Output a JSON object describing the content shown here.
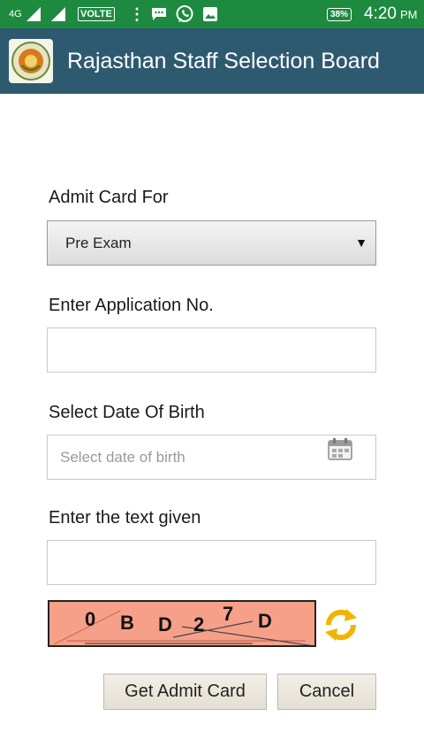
{
  "status_bar": {
    "network": "4G",
    "volte": "VOLTE",
    "battery": "38%",
    "time": "4:20",
    "ampm": "PM"
  },
  "app_bar": {
    "title": "Rajasthan Staff Selection Board"
  },
  "form": {
    "admit_card_for": {
      "label": "Admit Card For",
      "selected": "Pre Exam"
    },
    "application_no": {
      "label": "Enter Application No.",
      "value": ""
    },
    "dob": {
      "label": "Select Date Of Birth",
      "placeholder": "Select date of birth"
    },
    "captcha_input": {
      "label": "Enter the text given",
      "value": ""
    },
    "captcha": {
      "chars": [
        "0",
        "B",
        "D",
        "2",
        "7",
        "D"
      ]
    }
  },
  "buttons": {
    "get_admit_card": "Get Admit Card",
    "cancel": "Cancel"
  },
  "colors": {
    "status_bar": "#1d8a40",
    "app_bar": "#2e5a70",
    "captcha_bg": "#f6a08a",
    "refresh_icon": "#f2b400"
  }
}
